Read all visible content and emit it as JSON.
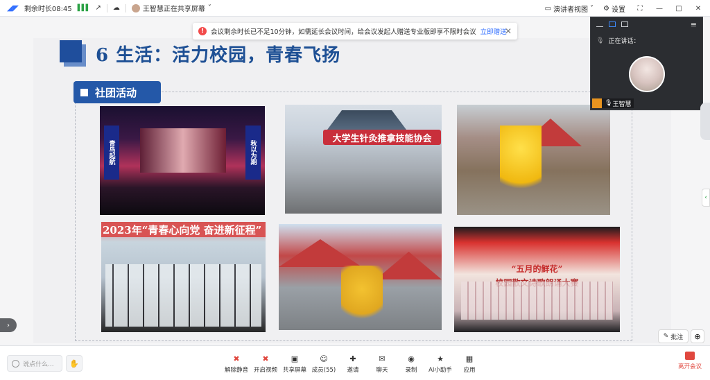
{
  "topbar": {
    "logo": "◢◤",
    "time_label": "剩余时长08:45",
    "signal": "▌▌▌",
    "sharing_label": "王智慧正在共享屏幕",
    "sharing_chevron": "˅",
    "view_label": "演讲者视图",
    "settings_label": "设置",
    "fullscreen_icon": "⛶",
    "minimize_icon": "—",
    "maximize_icon": "□",
    "close_icon": "✕"
  },
  "notice": {
    "icon": "!",
    "text": "会议剩余时长已不足10分钟，如需延长会议时间，给会议发起人赠送专业版即享不限时会议",
    "link": "立即赠送",
    "close": "✕"
  },
  "slide": {
    "title": "6  生活：活力校园，青春飞扬",
    "section": "社团活动",
    "photo2_banner": "大学生针灸推拿技能协会",
    "photo4_banner": "2023年“青春心向党  奋进新征程”",
    "photo1_pillar_left": "青鸟起航",
    "photo1_pillar_right": "秋以为期",
    "photo6_title": "“五月的鲜花”",
    "photo6_subtitle": "校园散文诗歌朗诵大赛"
  },
  "camera": {
    "speaking_label": "正在讲话：",
    "name": "王智慧",
    "menu_icon": "≡"
  },
  "controls": {
    "expand_left": "›",
    "right_arrow": "‹",
    "annotate_label": "批注",
    "zoom_icon": "⊕"
  },
  "bottombar": {
    "chat_placeholder": "说点什么...",
    "hand_icon": "✋",
    "tools": [
      {
        "label": "解除静音",
        "icon": "✖"
      },
      {
        "label": "开启视频",
        "icon": "✖"
      },
      {
        "label": "共享屏幕",
        "icon": "▣"
      },
      {
        "label": "成员(55)",
        "icon": "☺"
      },
      {
        "label": "邀请",
        "icon": "✚"
      },
      {
        "label": "聊天",
        "icon": "✉"
      },
      {
        "label": "录制",
        "icon": "◉"
      },
      {
        "label": "AI小助手",
        "icon": "★"
      },
      {
        "label": "应用",
        "icon": "▦"
      }
    ],
    "leave_label": "离开会议"
  }
}
